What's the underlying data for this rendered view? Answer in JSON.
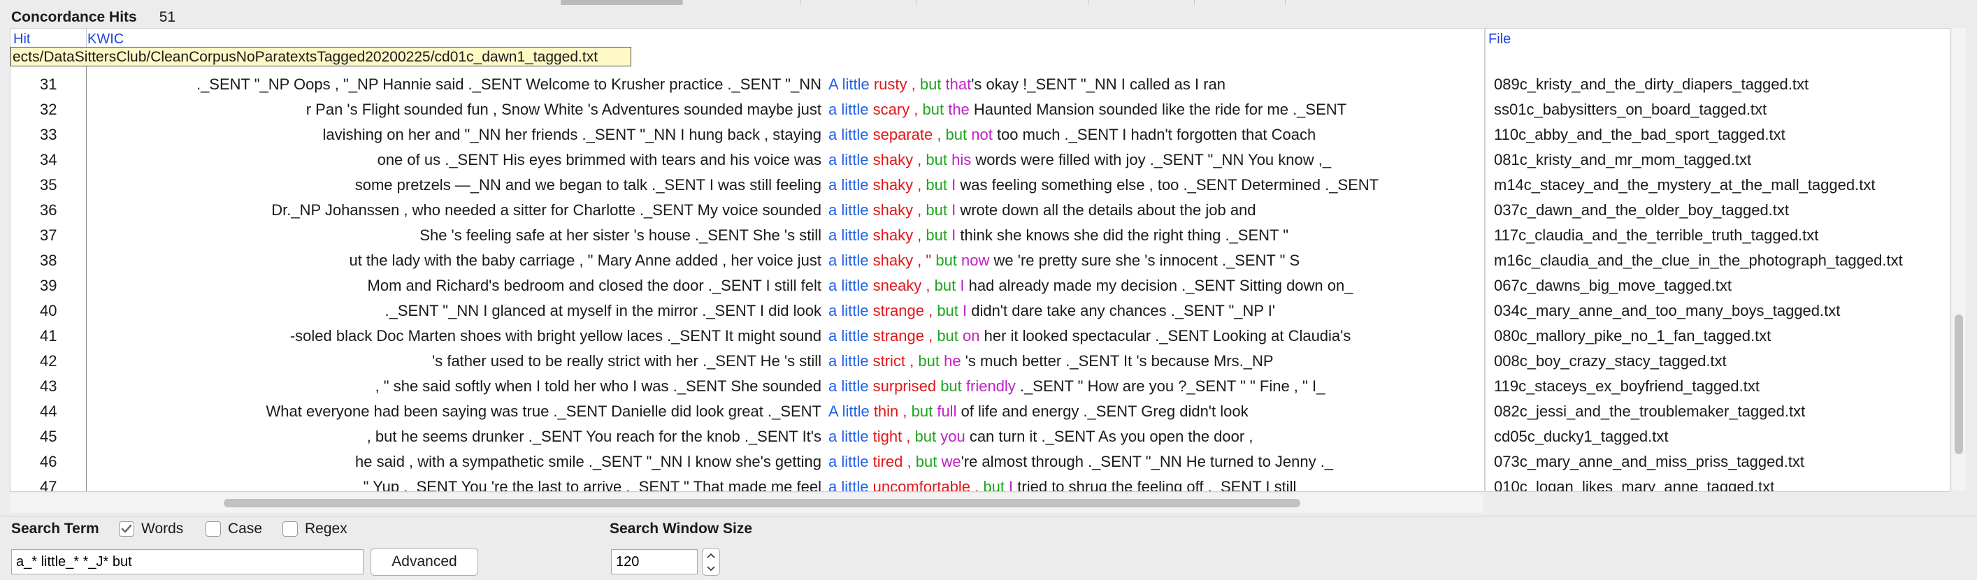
{
  "hits": {
    "title": "Concordance Hits",
    "count": "51"
  },
  "columns": {
    "hit": "Hit",
    "kwic": "KWIC",
    "file": "File"
  },
  "tooltip_path": "ects/DataSittersClub/CleanCorpusNoParatextsTagged20200225/cd01c_dawn1_tagged.txt",
  "rows": [
    {
      "num": "31",
      "left": "._SENT \"_NP Oops , \"_NP Hannie said ._SENT Welcome to Krusher practice ._SENT \"_NN",
      "kwic": [
        {
          "t": "A little ",
          "c": "blue"
        },
        {
          "t": "rusty , ",
          "c": "red"
        },
        {
          "t": "but ",
          "c": "green"
        },
        {
          "t": "that",
          "c": "purple"
        },
        {
          "t": "'s okay !_SENT \"_NN I called as I ran",
          "c": ""
        }
      ],
      "file": "089c_kristy_and_the_dirty_diapers_tagged.txt"
    },
    {
      "num": "32",
      "left": "r Pan 's Flight sounded fun , Snow White 's Adventures sounded maybe just",
      "kwic": [
        {
          "t": "a little ",
          "c": "blue"
        },
        {
          "t": "scary , ",
          "c": "red"
        },
        {
          "t": "but ",
          "c": "green"
        },
        {
          "t": "the",
          "c": "purple"
        },
        {
          "t": " Haunted Mansion sounded like the ride for me ._SENT",
          "c": ""
        }
      ],
      "file": "ss01c_babysitters_on_board_tagged.txt"
    },
    {
      "num": "33",
      "left": "lavishing on her and \"_NN her friends ._SENT \"_NN I hung back , staying",
      "kwic": [
        {
          "t": "a little ",
          "c": "blue"
        },
        {
          "t": "separate , ",
          "c": "red"
        },
        {
          "t": "but ",
          "c": "green"
        },
        {
          "t": "not",
          "c": "purple"
        },
        {
          "t": " too much ._SENT I hadn't forgotten that Coach",
          "c": ""
        }
      ],
      "file": "110c_abby_and_the_bad_sport_tagged.txt"
    },
    {
      "num": "34",
      "left": "one of us ._SENT His eyes brimmed with tears and his voice was",
      "kwic": [
        {
          "t": "a little ",
          "c": "blue"
        },
        {
          "t": "shaky , ",
          "c": "red"
        },
        {
          "t": "but ",
          "c": "green"
        },
        {
          "t": "his",
          "c": "purple"
        },
        {
          "t": " words were filled with joy ._SENT \"_NN You know ,_",
          "c": ""
        }
      ],
      "file": "081c_kristy_and_mr_mom_tagged.txt"
    },
    {
      "num": "35",
      "left": "some pretzels —_NN and we began to talk ._SENT I was still feeling",
      "kwic": [
        {
          "t": "a little ",
          "c": "blue"
        },
        {
          "t": "shaky , ",
          "c": "red"
        },
        {
          "t": "but ",
          "c": "green"
        },
        {
          "t": "I",
          "c": "purple"
        },
        {
          "t": " was feeling something else , too ._SENT Determined ._SENT",
          "c": ""
        }
      ],
      "file": "m14c_stacey_and_the_mystery_at_the_mall_tagged.txt"
    },
    {
      "num": "36",
      "left": "Dr._NP Johanssen , who needed a sitter for Charlotte ._SENT My voice sounded",
      "kwic": [
        {
          "t": "a little ",
          "c": "blue"
        },
        {
          "t": "shaky , ",
          "c": "red"
        },
        {
          "t": "but ",
          "c": "green"
        },
        {
          "t": "I",
          "c": "purple"
        },
        {
          "t": " wrote down all the details about the job and",
          "c": ""
        }
      ],
      "file": "037c_dawn_and_the_older_boy_tagged.txt"
    },
    {
      "num": "37",
      "left": "She 's feeling safe at her sister 's house ._SENT She 's still",
      "kwic": [
        {
          "t": "a little ",
          "c": "blue"
        },
        {
          "t": "shaky , ",
          "c": "red"
        },
        {
          "t": "but ",
          "c": "green"
        },
        {
          "t": "I",
          "c": "purple"
        },
        {
          "t": " think she knows she did the right thing ._SENT \"",
          "c": ""
        }
      ],
      "file": "117c_claudia_and_the_terrible_truth_tagged.txt"
    },
    {
      "num": "38",
      "left": "ut the lady with the baby carriage , \" Mary Anne added , her voice just",
      "kwic": [
        {
          "t": "a little ",
          "c": "blue"
        },
        {
          "t": "shaky , \" ",
          "c": "red"
        },
        {
          "t": "but ",
          "c": "green"
        },
        {
          "t": "now",
          "c": "purple"
        },
        {
          "t": " we 're pretty sure she 's innocent ._SENT \" S",
          "c": ""
        }
      ],
      "file": "m16c_claudia_and_the_clue_in_the_photograph_tagged.txt"
    },
    {
      "num": "39",
      "left": "Mom and Richard's bedroom and closed the door ._SENT I still felt",
      "kwic": [
        {
          "t": "a little ",
          "c": "blue"
        },
        {
          "t": "sneaky , ",
          "c": "red"
        },
        {
          "t": "but ",
          "c": "green"
        },
        {
          "t": "I",
          "c": "purple"
        },
        {
          "t": " had already made my decision ._SENT Sitting down on_",
          "c": ""
        }
      ],
      "file": "067c_dawns_big_move_tagged.txt"
    },
    {
      "num": "40",
      "left": "._SENT \"_NN I glanced at myself in the mirror ._SENT I did look",
      "kwic": [
        {
          "t": "a little ",
          "c": "blue"
        },
        {
          "t": "strange , ",
          "c": "red"
        },
        {
          "t": "but ",
          "c": "green"
        },
        {
          "t": "I",
          "c": "purple"
        },
        {
          "t": " didn't dare take any chances ._SENT \"_NP I'",
          "c": ""
        }
      ],
      "file": "034c_mary_anne_and_too_many_boys_tagged.txt"
    },
    {
      "num": "41",
      "left": "-soled black Doc Marten shoes with bright yellow laces ._SENT It might sound",
      "kwic": [
        {
          "t": "a little ",
          "c": "blue"
        },
        {
          "t": "strange , ",
          "c": "red"
        },
        {
          "t": "but ",
          "c": "green"
        },
        {
          "t": "on",
          "c": "purple"
        },
        {
          "t": " her it looked spectacular ._SENT Looking at Claudia's",
          "c": ""
        }
      ],
      "file": "080c_mallory_pike_no_1_fan_tagged.txt"
    },
    {
      "num": "42",
      "left": "'s father used to be really strict with her ._SENT He 's still",
      "kwic": [
        {
          "t": "a little ",
          "c": "blue"
        },
        {
          "t": "strict , ",
          "c": "red"
        },
        {
          "t": "but ",
          "c": "green"
        },
        {
          "t": "he",
          "c": "purple"
        },
        {
          "t": " 's much better ._SENT It 's because Mrs._NP",
          "c": ""
        }
      ],
      "file": "008c_boy_crazy_stacy_tagged.txt"
    },
    {
      "num": "43",
      "left": ", \" she said softly when I told her who I was ._SENT She sounded",
      "kwic": [
        {
          "t": "a little ",
          "c": "blue"
        },
        {
          "t": "surprised ",
          "c": "red"
        },
        {
          "t": "but ",
          "c": "green"
        },
        {
          "t": "friendly",
          "c": "purple"
        },
        {
          "t": " ._SENT \" How are you ?_SENT \" \" Fine , \" I_",
          "c": ""
        }
      ],
      "file": "119c_staceys_ex_boyfriend_tagged.txt"
    },
    {
      "num": "44",
      "left": "What everyone had been saying was true ._SENT Danielle did look great ._SENT",
      "kwic": [
        {
          "t": "A little ",
          "c": "blue"
        },
        {
          "t": "thin , ",
          "c": "red"
        },
        {
          "t": "but ",
          "c": "green"
        },
        {
          "t": "full",
          "c": "purple"
        },
        {
          "t": " of life and energy ._SENT Greg didn't look",
          "c": ""
        }
      ],
      "file": "082c_jessi_and_the_troublemaker_tagged.txt"
    },
    {
      "num": "45",
      "left": ", but he seems drunker ._SENT You reach for the knob ._SENT It's",
      "kwic": [
        {
          "t": "a little ",
          "c": "blue"
        },
        {
          "t": "tight , ",
          "c": "red"
        },
        {
          "t": "but ",
          "c": "green"
        },
        {
          "t": "you",
          "c": "purple"
        },
        {
          "t": " can turn it ._SENT As you open the door ,",
          "c": ""
        }
      ],
      "file": "cd05c_ducky1_tagged.txt"
    },
    {
      "num": "46",
      "left": "he said , with a sympathetic smile ._SENT \"_NN I know she's getting",
      "kwic": [
        {
          "t": "a little ",
          "c": "blue"
        },
        {
          "t": "tired , ",
          "c": "red"
        },
        {
          "t": "but ",
          "c": "green"
        },
        {
          "t": "we",
          "c": "purple"
        },
        {
          "t": "'re almost through ._SENT \"_NN He turned to Jenny ._",
          "c": ""
        }
      ],
      "file": "073c_mary_anne_and_miss_priss_tagged.txt"
    },
    {
      "num": "47",
      "left": "\" Yup ._SENT You 're the last to arrive ._SENT \" That made me feel",
      "kwic": [
        {
          "t": "a little ",
          "c": "blue"
        },
        {
          "t": "uncomfortable , ",
          "c": "red"
        },
        {
          "t": "but ",
          "c": "green"
        },
        {
          "t": "I",
          "c": "purple"
        },
        {
          "t": " tried to shrug the feeling off ._SENT I still",
          "c": ""
        }
      ],
      "file": "010c_logan_likes_mary_anne_tagged.txt"
    }
  ],
  "controls": {
    "search_term_label": "Search Term",
    "words_label": "Words",
    "words_checked": true,
    "case_label": "Case",
    "regex_label": "Regex",
    "search_value": "a_* little_* *_J* but",
    "advanced_label": "Advanced",
    "window_size_label": "Search Window Size",
    "window_size_value": "120"
  },
  "colors": {
    "blue": "#2361e6",
    "red": "#e1161a",
    "green": "#1ea51e",
    "purple": "#c021c8",
    "link": "#2244dd"
  }
}
